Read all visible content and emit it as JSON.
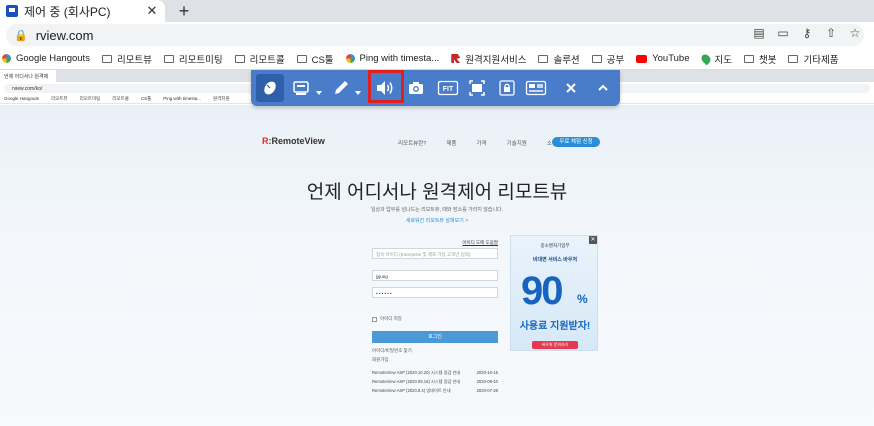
{
  "browser": {
    "tab": {
      "title": "제어 중 (회사PC)",
      "close": "✕"
    },
    "new_tab": "+",
    "url": "rview.com",
    "bookmarks": [
      {
        "label": "Google Hangouts",
        "icon": "google-icon"
      },
      {
        "label": "리모트뷰",
        "icon": "folder-icon"
      },
      {
        "label": "리모트미팅",
        "icon": "folder-icon"
      },
      {
        "label": "리모트콜",
        "icon": "folder-icon"
      },
      {
        "label": "CS툴",
        "icon": "folder-icon"
      },
      {
        "label": "Ping with timesta...",
        "icon": "ping-icon"
      },
      {
        "label": "원격지원서비스",
        "icon": "rsupport-icon"
      },
      {
        "label": "솔루션",
        "icon": "folder-icon"
      },
      {
        "label": "공부",
        "icon": "folder-icon"
      },
      {
        "label": "YouTube",
        "icon": "youtube-icon"
      },
      {
        "label": "지도",
        "icon": "maps-icon"
      },
      {
        "label": "챗봇",
        "icon": "folder-icon"
      },
      {
        "label": "기타제품",
        "icon": "folder-icon"
      }
    ]
  },
  "remote": {
    "inner_tab_title": "언제 어디서나 원격제",
    "inner_url": "rview.com/ko/",
    "inner_bookmarks": [
      "Google Hangouts",
      "리모트뷰",
      "리모트미팅",
      "리모트콜",
      "CS툴",
      "Ping with timesta...",
      "원격지원"
    ],
    "site": {
      "logo_prefix": "R",
      "logo_text": ":RemoteView",
      "nav": [
        "리모트뷰란?",
        "제품",
        "가격",
        "기술지원",
        "소식"
      ],
      "cta": "무료 체험 신청",
      "hero_title": "언제 어디서나 원격제어 리모트뷰",
      "hero_sub": "일상과 업무를 넘나드는 리모트뷰, 때와 장소를 가리지 않습니다.",
      "hero_link": "새로워진 리모트뷰 살펴보기 >",
      "login": {
        "top_link": "아이디 도메 도움말",
        "field1": "접속 아이디 (Enterprise 및 제로 가입 고객만 입력)",
        "field2": "jyjung",
        "field3": "• • • • • •",
        "remember": "아이디 저장",
        "submit": "로그인",
        "find": "아이디/비밀번호 찾기",
        "signup": "회원가입"
      },
      "news": [
        {
          "title": "RemoteView ASP (2020.10.20) 시스템 점검 안내",
          "date": "2020-10-15"
        },
        {
          "title": "RemoteView ASP (2020.09.16) 시스템 점검 안내",
          "date": "2020-09-10"
        },
        {
          "title": "RemoteView ASP (2020.8.4) 업데이트 안내",
          "date": "2020-07-28"
        }
      ],
      "ad": {
        "org": "중소벤처기업부",
        "head": "비대면 서비스 바우처",
        "big": "90",
        "pct": "%",
        "sub": "사용료 지원받자!",
        "button": "바우처 문의하기",
        "close": "✕"
      }
    }
  },
  "toolbar": {
    "buttons": [
      "mouse-control",
      "keyboard",
      "draw",
      "sound",
      "screenshot",
      "fit",
      "fullscreen",
      "lock",
      "multi-monitor",
      "close",
      "collapse"
    ],
    "fit_label": "FIT",
    "highlighted": "sound"
  },
  "colors": {
    "toolbar_bg": "#4a7dc9",
    "highlight": "#e02020",
    "accent": "#2a8fd6"
  }
}
